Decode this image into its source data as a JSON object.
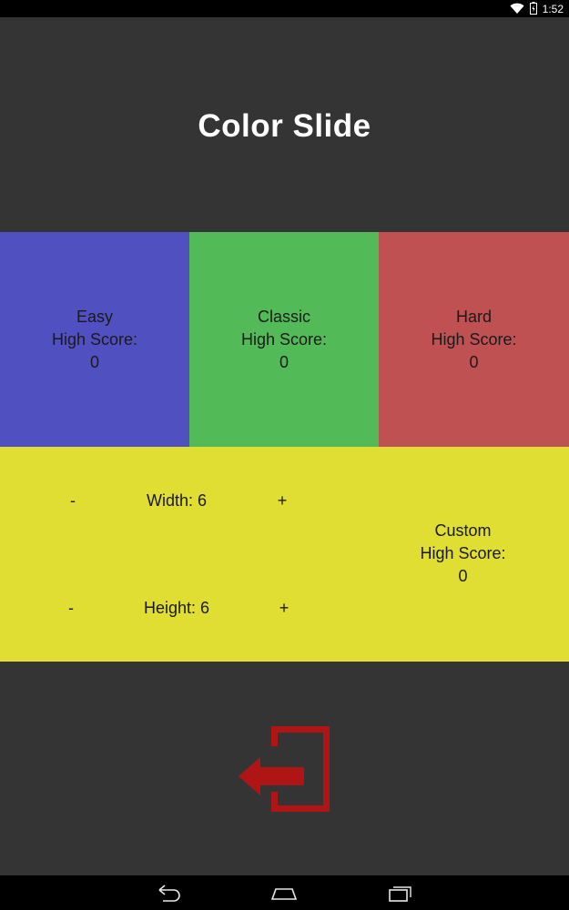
{
  "status_bar": {
    "time": "1:52",
    "icons": [
      "wifi-icon",
      "battery-icon"
    ]
  },
  "header": {
    "title": "Color Slide"
  },
  "modes": [
    {
      "name": "Easy",
      "score_label": "High Score:",
      "score": "0",
      "color": "#5150c1"
    },
    {
      "name": "Classic",
      "score_label": "High Score:",
      "score": "0",
      "color": "#52bb57"
    },
    {
      "name": "Hard",
      "score_label": "High Score:",
      "score": "0",
      "color": "#c05152"
    }
  ],
  "custom": {
    "color": "#e0de32",
    "width_label": "Width: 6",
    "height_label": "Height: 6",
    "decrement": "-",
    "increment": "+",
    "name": "Custom",
    "score_label": "High Score:",
    "score": "0"
  },
  "exit": {
    "icon": "exit-icon",
    "color": "#b01516"
  },
  "nav_bar": {
    "icons": [
      "back-icon",
      "home-icon",
      "recents-icon"
    ]
  }
}
